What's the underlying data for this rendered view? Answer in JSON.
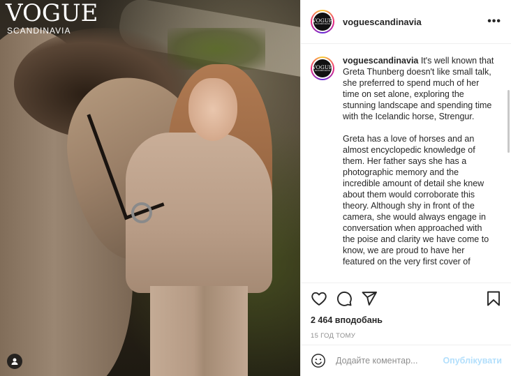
{
  "photo": {
    "logo_title": "VOGUE",
    "logo_subtitle": "SCANDINAVIA",
    "tag_icon": "user-tag-icon"
  },
  "header": {
    "avatar_text": "VOGUE",
    "avatar_subtext": "SCANDINAVIA",
    "username": "voguescandinavia",
    "more_label": "•••"
  },
  "caption": {
    "username": "voguescandinavia",
    "paragraph_1": " It's well known that Greta Thunberg doesn't like small talk, she preferred to spend much of her time on set alone, exploring the stunning landscape and spending time with the Icelandic horse, Strengur.",
    "paragraph_2": "Greta has a love of horses and an almost encyclopedic knowledge of them. Her father says she has a photographic memory and the incredible amount of detail she knew about them would corroborate this theory. Although shy in front of the camera, she would always engage in conversation when approached with the poise and clarity we have come to know, we are proud to have her featured on the very first cover of"
  },
  "actions": {
    "icons": [
      "heart-icon",
      "comment-icon",
      "share-icon",
      "bookmark-icon"
    ],
    "likes": "2 464 вподобань",
    "time": "15 ГОД ТОМУ"
  },
  "comment": {
    "placeholder": "Додайте коментар...",
    "post_label": "Опублікувати"
  },
  "colors": {
    "link_blue_disabled": "#b2dffc",
    "muted_gray": "#8e8e8e",
    "text_dark": "#262626"
  }
}
